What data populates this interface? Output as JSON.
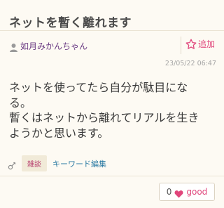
{
  "post": {
    "title": "ネットを暫く離れます",
    "author": "如月みかんちゃん",
    "add_label": "追加",
    "timestamp": "23/05/22 06:47",
    "body_lines": [
      "ネットを使ってたら自分が駄目にな",
      "る。",
      "暫くはネットから離れてリアルを生き",
      "ようかと思います。"
    ]
  },
  "tags": {
    "category": "雑談",
    "keyword_edit": "キーワード編集"
  },
  "good": {
    "count": "0",
    "label": "good"
  },
  "colors": {
    "accent_pink": "#e0457b",
    "author_purple": "#6b3b83",
    "link_blue": "#2a7aa3",
    "background": "#fdfaf3"
  },
  "icons": {
    "user": "user-icon",
    "star": "star-outline-icon",
    "tag": "tag-icon",
    "heart": "heart-icon"
  }
}
